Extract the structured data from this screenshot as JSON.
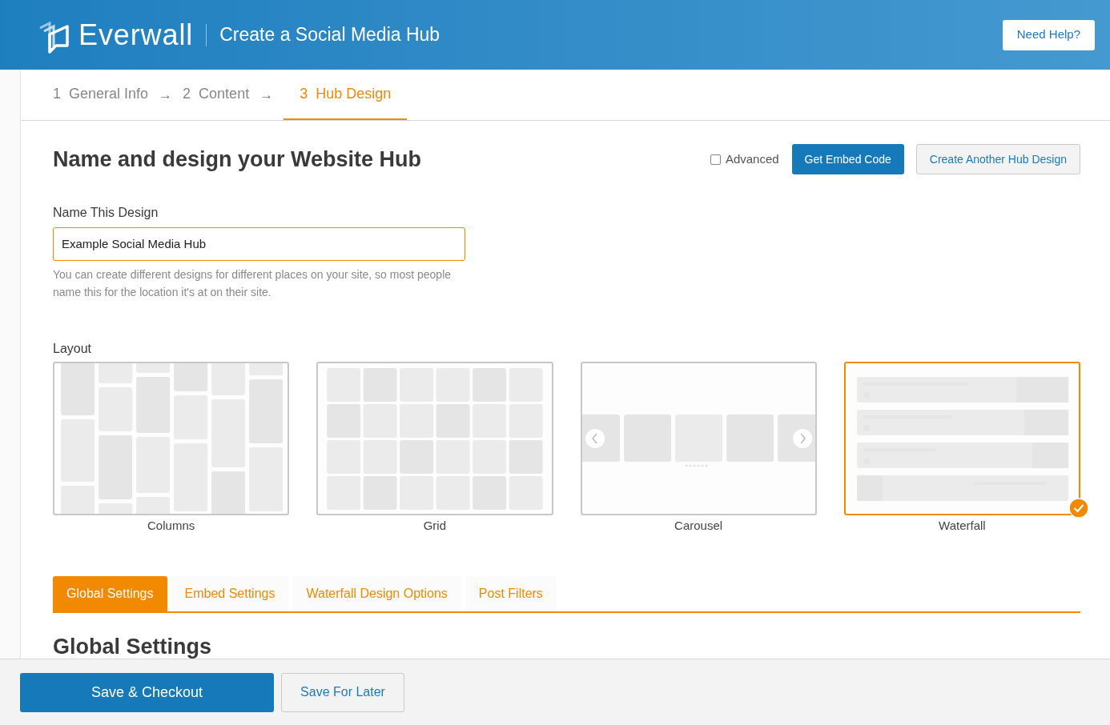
{
  "header": {
    "brand": "Everwall",
    "title": "Create a Social Media Hub",
    "help_button": "Need Help?"
  },
  "steps": [
    {
      "number": "1",
      "label": "General Info",
      "selected": false
    },
    {
      "arrow": "→",
      "number": "2",
      "label": "Content",
      "selected": false
    },
    {
      "arrow": "→",
      "number": "3",
      "label": "Hub Design",
      "selected": true
    }
  ],
  "page_title": "Name and design your Website Hub",
  "advanced": {
    "label": "Advanced",
    "checked": false
  },
  "actions": {
    "primary": "Get Embed Code",
    "secondary": "Create Another Hub Design"
  },
  "name_field": {
    "label": "Name This Design",
    "value": "Example Social Media Hub",
    "help": "You can create different designs for different places on your site, so most people name this for the location it's at on their site."
  },
  "layout": {
    "label": "Layout",
    "options": [
      {
        "kind": "columns",
        "label": "Columns",
        "selected": false
      },
      {
        "kind": "grid",
        "label": "Grid",
        "selected": false
      },
      {
        "kind": "carousel",
        "label": "Carousel",
        "selected": false
      },
      {
        "kind": "waterfall",
        "label": "Waterfall",
        "selected": true
      }
    ]
  },
  "tabs": [
    {
      "label": "Global Settings",
      "selected": true
    },
    {
      "label": "Embed Settings",
      "selected": false
    },
    {
      "label": "Waterfall Design Options",
      "selected": false
    },
    {
      "label": "Post Filters",
      "selected": false
    }
  ],
  "section_heading": "Global Settings",
  "footer": {
    "primary": "Save & Checkout",
    "secondary": "Save For Later"
  }
}
